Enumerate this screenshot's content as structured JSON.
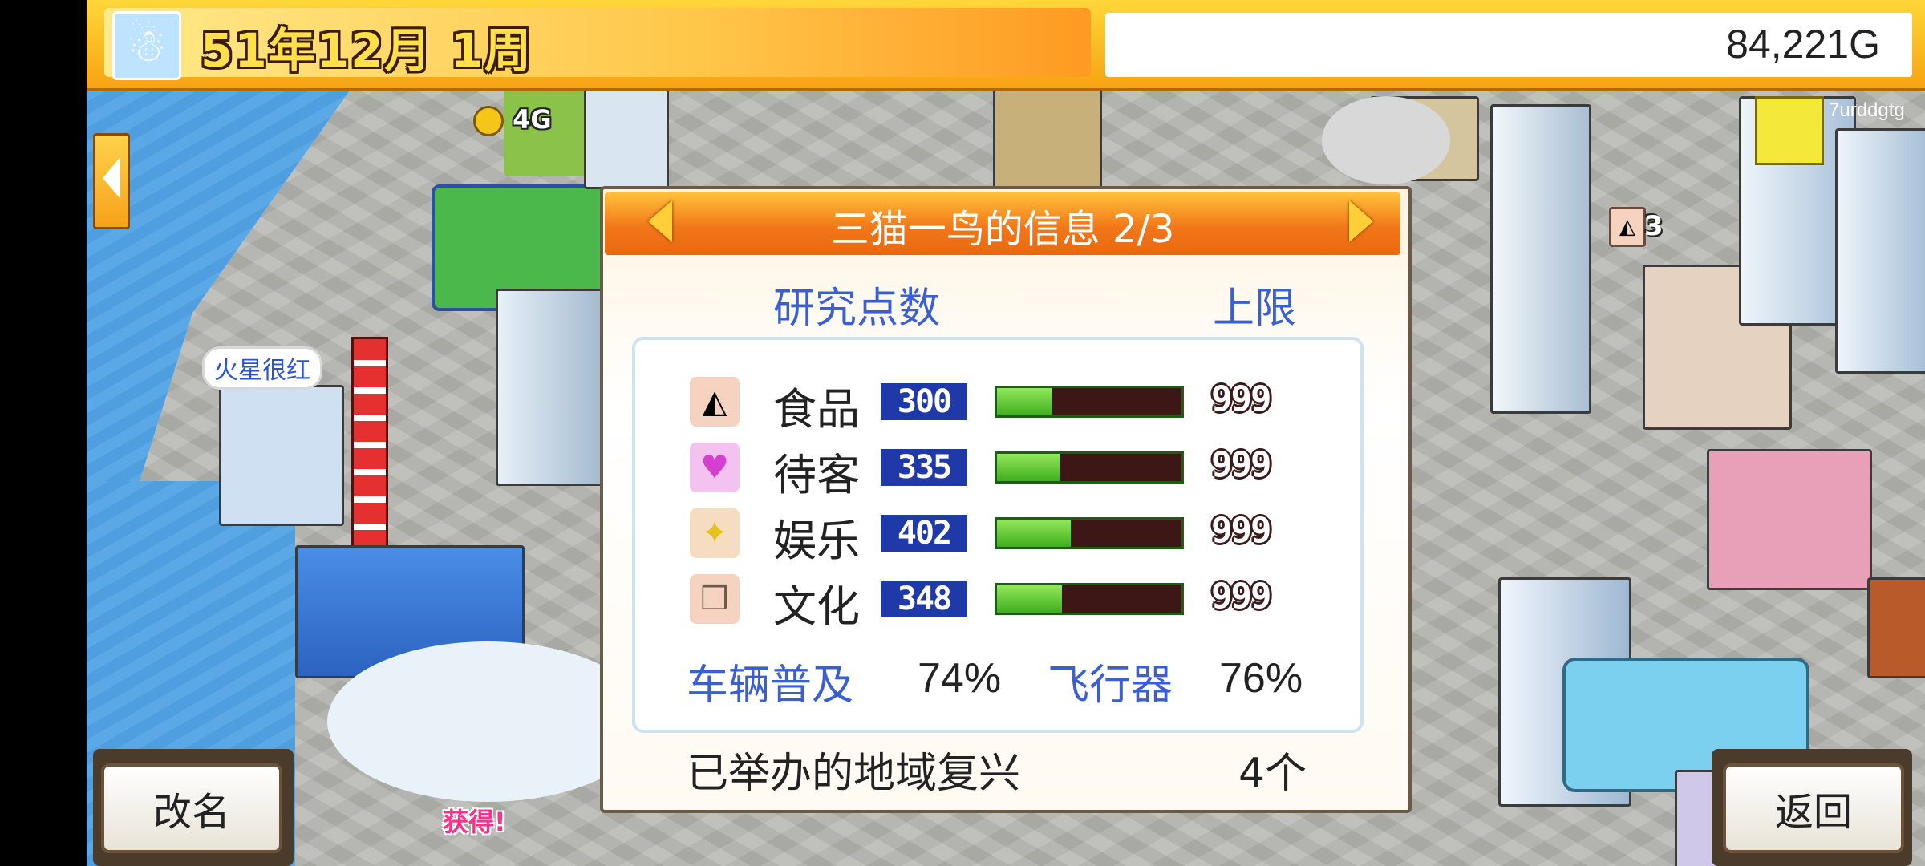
{
  "header": {
    "date": "51年12月 1周",
    "money": "84,221G",
    "user_tag": "7urddgtg",
    "season_icon": "snowman-icon"
  },
  "map": {
    "coin_label": "4G",
    "bubble_label": "火星很红",
    "figure_count": "3",
    "status_text": "获得!"
  },
  "dialog": {
    "title": "三猫一鸟的信息 2/3",
    "col_points": "研究点数",
    "col_limit": "上限",
    "stats": [
      {
        "icon": "rice-ball-icon",
        "name": "食品",
        "value": "300",
        "max": "999",
        "fill": 0.3
      },
      {
        "icon": "heart-icon",
        "name": "待客",
        "value": "335",
        "max": "999",
        "fill": 0.34
      },
      {
        "icon": "sparkle-icon",
        "name": "娱乐",
        "value": "402",
        "max": "999",
        "fill": 0.4
      },
      {
        "icon": "book-icon",
        "name": "文化",
        "value": "348",
        "max": "999",
        "fill": 0.35
      }
    ],
    "vehicle_label": "车辆普及",
    "vehicle_pct": "74%",
    "aircraft_label": "飞行器",
    "aircraft_pct": "76%",
    "revival_label": "已举办的地域复兴",
    "revival_count": "4个"
  },
  "buttons": {
    "rename": "改名",
    "back": "返回"
  }
}
